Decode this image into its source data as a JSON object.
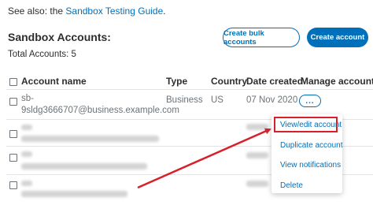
{
  "see_also": {
    "prefix": "See also: the ",
    "link": "Sandbox Testing Guide",
    "suffix": "."
  },
  "header": {
    "title": "Sandbox Accounts:",
    "total": "Total Accounts: 5"
  },
  "buttons": {
    "bulk": "Create bulk accounts",
    "create": "Create account"
  },
  "table": {
    "columns": [
      "Account name",
      "Type",
      "Country",
      "Date created",
      "Manage accounts"
    ],
    "row1": {
      "account_line1": "sb-",
      "account_line2": "9sldg3666707@business.example.com",
      "type": "Business",
      "country": "US",
      "date": "07 Nov 2020",
      "manage": "..."
    }
  },
  "menu": {
    "items": [
      "View/edit account",
      "Duplicate account",
      "View notifications",
      "Delete"
    ]
  },
  "colors": {
    "accent": "#0070ba",
    "annotation": "#d8202a"
  }
}
